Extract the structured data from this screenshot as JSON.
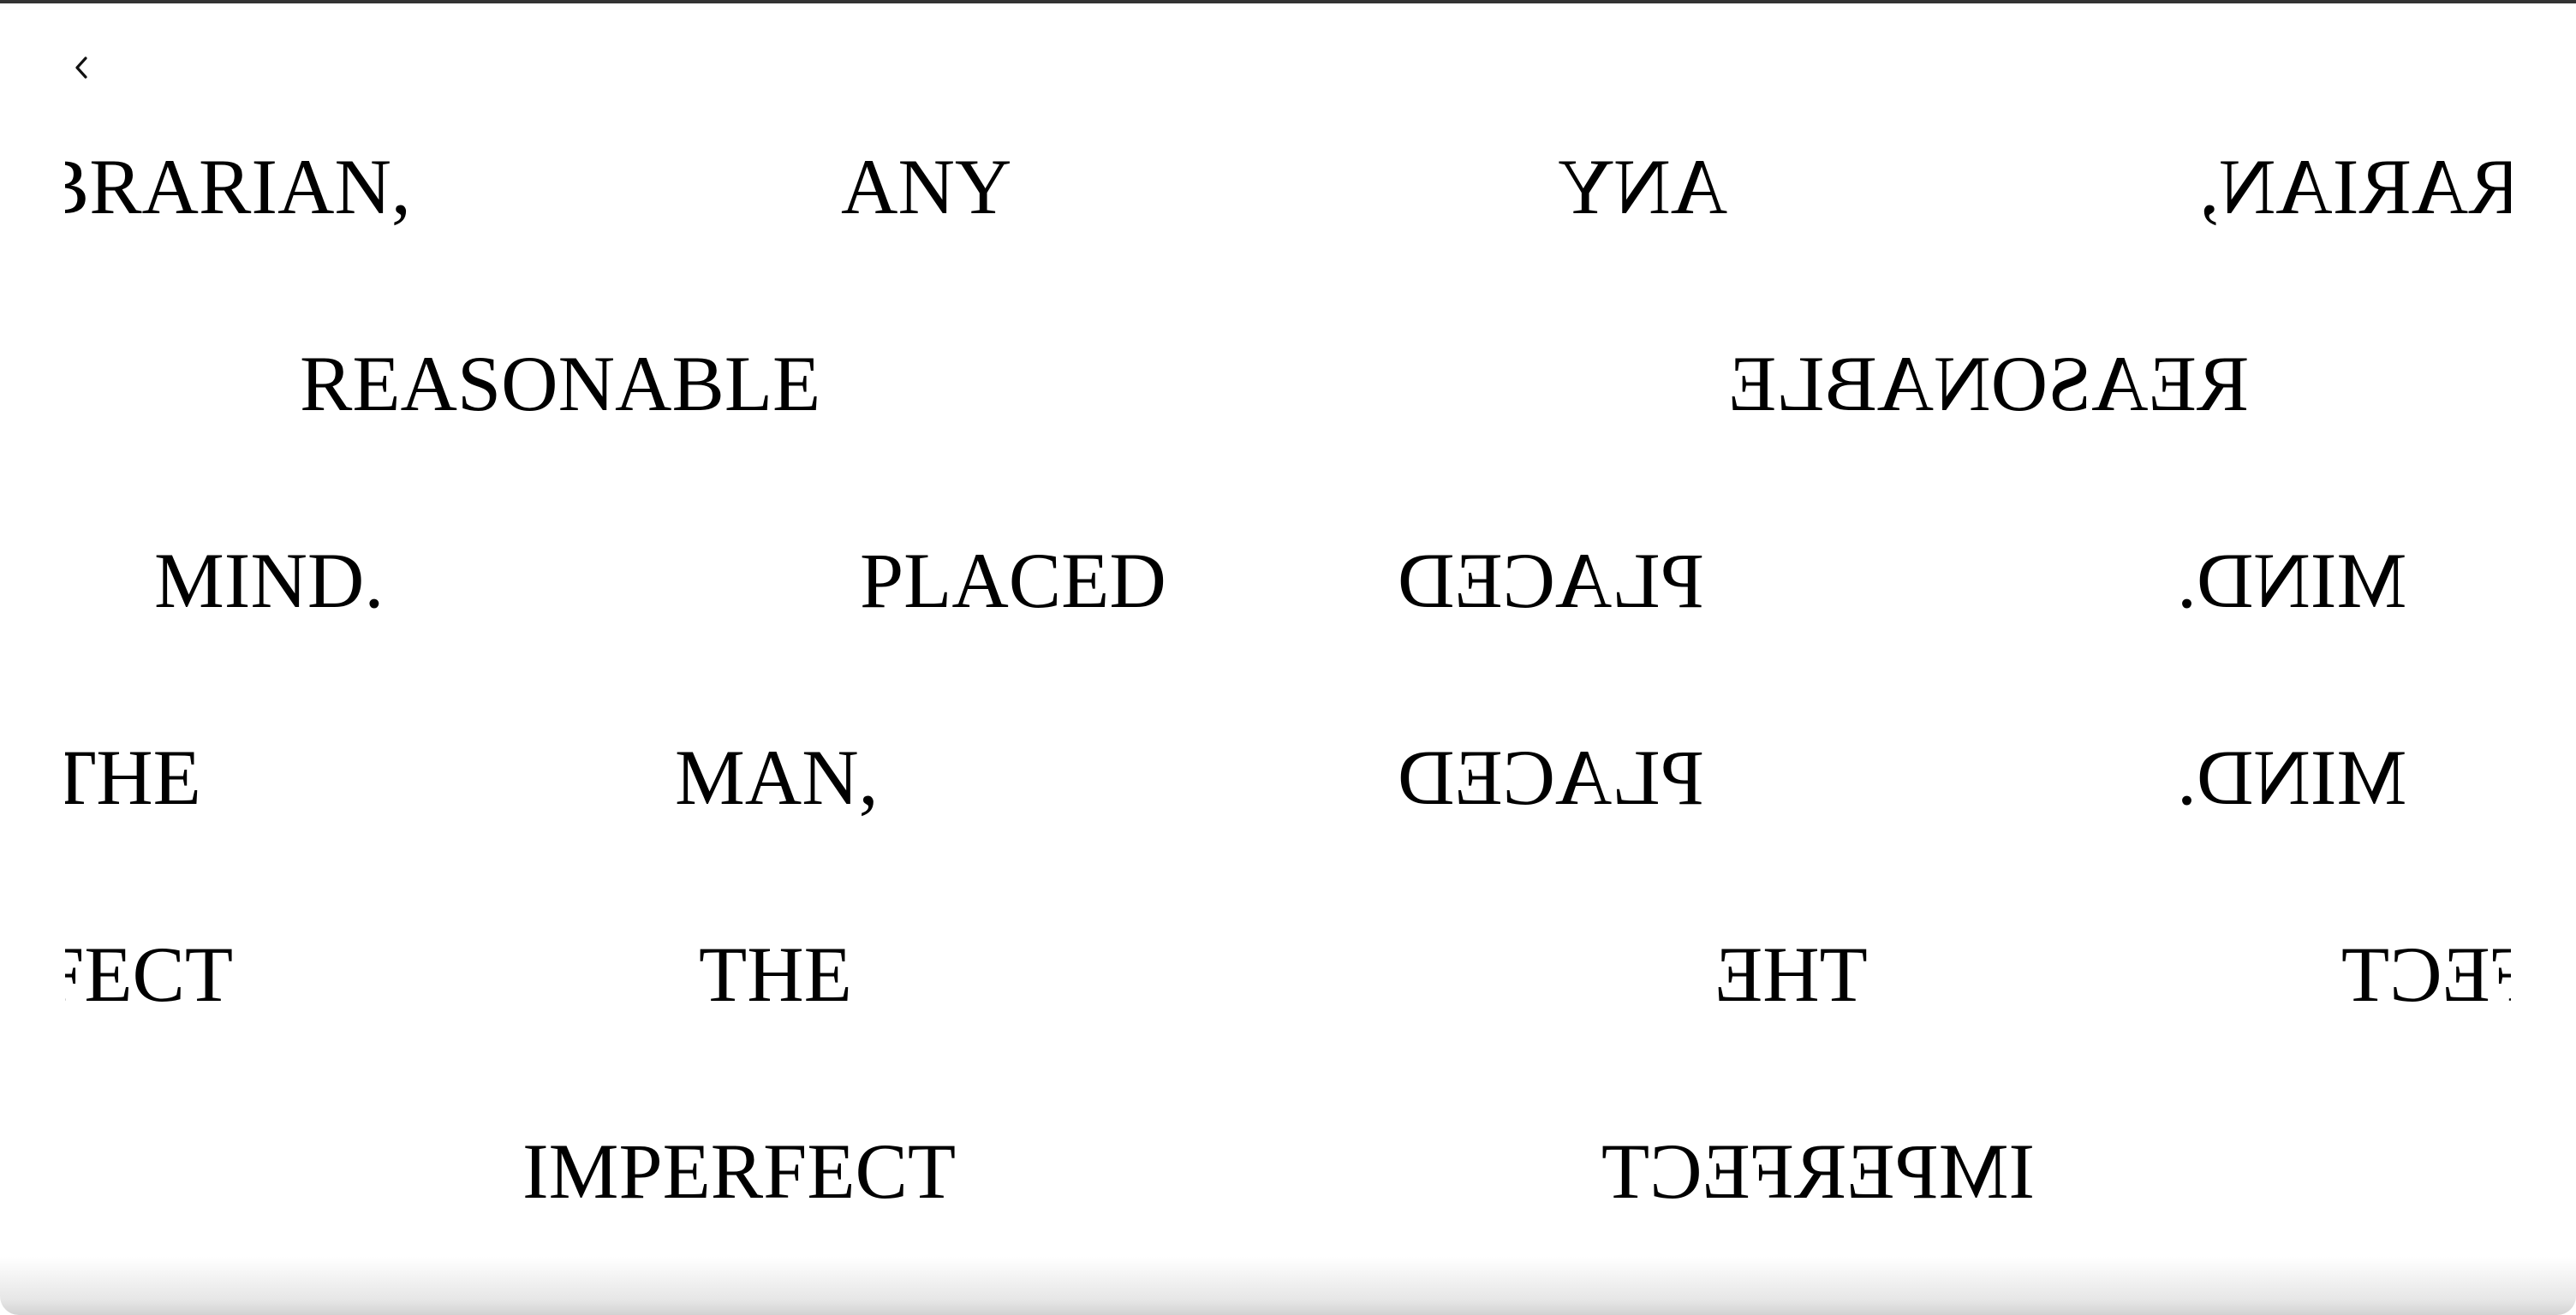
{
  "navigation": {
    "back_icon": "chevron-left-icon"
  },
  "rows": [
    {
      "left": [
        "LIBRARIAN,",
        "ANY"
      ],
      "right": [
        "ANY",
        "LIBRARIAN,"
      ]
    },
    {
      "left": [
        "REASONABLE"
      ],
      "right": [
        "REASONABLE"
      ]
    },
    {
      "left": [
        "MIND.",
        "PLACED"
      ],
      "right": [
        "PLACED",
        "MIND."
      ]
    },
    {
      "left": [
        "THE",
        "MAN,"
      ],
      "right": [
        "PLACED",
        "MIND."
      ]
    },
    {
      "left": [
        "IMPERFECT",
        "THE"
      ],
      "right": [
        "THE",
        "IMPERFECT"
      ]
    },
    {
      "left": [
        "IMPERFECT"
      ],
      "right": [
        "IMPERFECT"
      ]
    }
  ]
}
